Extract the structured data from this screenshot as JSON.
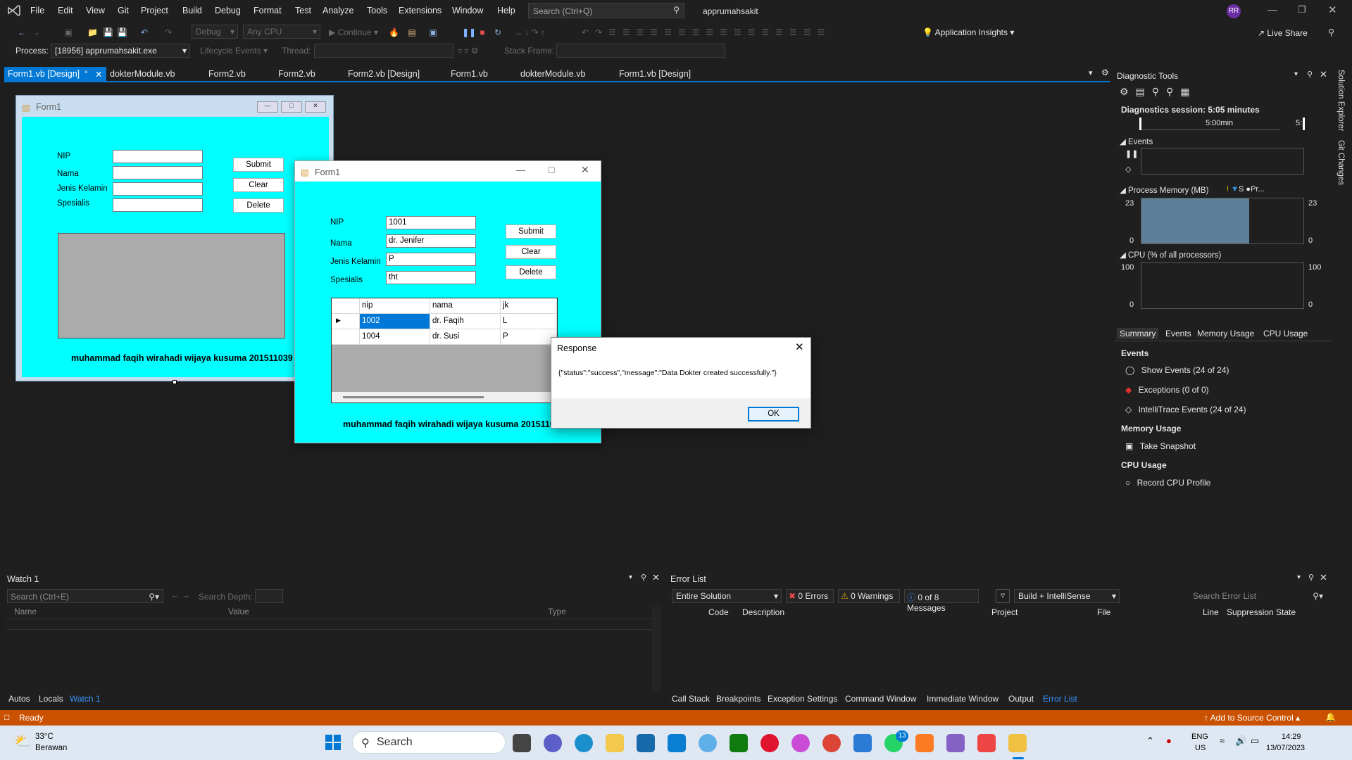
{
  "menu": [
    "File",
    "Edit",
    "View",
    "Git",
    "Project",
    "Build",
    "Debug",
    "Format",
    "Test",
    "Analyze",
    "Tools",
    "Extensions",
    "Window",
    "Help"
  ],
  "search": {
    "placeholder": "Search (Ctrl+Q)"
  },
  "solution_name": "apprumahsakit",
  "user_initials": "RR",
  "toolbar": {
    "config": "Debug",
    "platform": "Any CPU",
    "continue": "Continue",
    "app_insights": "Application Insights",
    "live_share": "Live Share"
  },
  "toolbar2": {
    "process_label": "Process:",
    "process_value": "[18956] apprumahsakit.exe",
    "lifecycle": "Lifecycle Events",
    "thread_label": "Thread:",
    "stackframe_label": "Stack Frame:"
  },
  "tabs": [
    "Form1.vb [Design]",
    "dokterModule.vb",
    "Form2.vb",
    "Form2.vb",
    "Form2.vb [Design]",
    "Form1.vb",
    "dokterModule.vb",
    "Form1.vb [Design]"
  ],
  "design_form": {
    "title": "Form1",
    "labels": [
      "NIP",
      "Nama",
      "Jenis Kelamin",
      "Spesialis"
    ],
    "buttons": [
      "Submit",
      "Clear",
      "Delete"
    ],
    "credit": "muhammad faqih wirahadi wijaya kusuma 201511039"
  },
  "runtime_form": {
    "title": "Form1",
    "labels": [
      "NIP",
      "Nama",
      "Jenis Kelamin",
      "Spesialis"
    ],
    "values": [
      "1001",
      "dr. Jenifer",
      "P",
      "tht"
    ],
    "buttons": [
      "Submit",
      "Clear",
      "Delete"
    ],
    "grid": {
      "columns": [
        "nip",
        "nama",
        "jk"
      ],
      "rows": [
        [
          "1002",
          "dr. Faqih",
          "L"
        ],
        [
          "1004",
          "dr. Susi",
          "P"
        ]
      ]
    },
    "credit": "muhammad faqih wirahadi wijaya kusuma 201511039"
  },
  "msgbox": {
    "title": "Response",
    "message": "{\"status\":\"success\",\"message\":\"Data Dokter created successfully.\"}",
    "ok": "OK"
  },
  "diag": {
    "title": "Diagnostic Tools",
    "session": "Diagnostics session: 5:05 minutes",
    "time_marker": "5:00min",
    "time_marker2": "5:",
    "events_header": "Events",
    "memory_header": "Process Memory (MB)",
    "memory_legend_s": "S",
    "memory_legend_p": "Pr...",
    "mem_max": "23",
    "mem_min": "0",
    "mem_level_pct": 100,
    "cpu_header": "CPU (% of all processors)",
    "cpu_max": "100",
    "cpu_min": "0",
    "tabs": [
      "Summary",
      "Events",
      "Memory Usage",
      "CPU Usage"
    ],
    "sec_events": "Events",
    "show_events": "Show Events (24 of 24)",
    "exceptions": "Exceptions (0 of 0)",
    "intellitrace": "IntelliTrace Events (24 of 24)",
    "sec_memory": "Memory Usage",
    "snapshot": "Take Snapshot",
    "sec_cpu": "CPU Usage",
    "record_cpu": "Record CPU Profile"
  },
  "side_tabs": [
    "Solution Explorer",
    "Git Changes"
  ],
  "watch": {
    "title": "Watch 1",
    "search": "Search (Ctrl+E)",
    "depth": "Search Depth:",
    "columns": [
      "Name",
      "Value",
      "Type"
    ],
    "tabs": [
      "Autos",
      "Locals",
      "Watch 1"
    ]
  },
  "errors": {
    "title": "Error List",
    "scope": "Entire Solution",
    "errors": "0 Errors",
    "warnings": "0 Warnings",
    "messages": "0 of 8 Messages",
    "build": "Build + IntelliSense",
    "search": "Search Error List",
    "columns": [
      "Code",
      "Description",
      "Project",
      "File",
      "Line",
      "Suppression State"
    ],
    "tabs": [
      "Call Stack",
      "Breakpoints",
      "Exception Settings",
      "Command Window",
      "Immediate Window",
      "Output",
      "Error List"
    ]
  },
  "status": {
    "ready": "Ready",
    "source_control": "Add to Source Control"
  },
  "taskbar": {
    "temp": "33°C",
    "weather": "Berawan",
    "search": "Search",
    "lang1": "ENG",
    "lang2": "US",
    "time": "14:29",
    "date": "13/07/2023",
    "badge": "13"
  }
}
